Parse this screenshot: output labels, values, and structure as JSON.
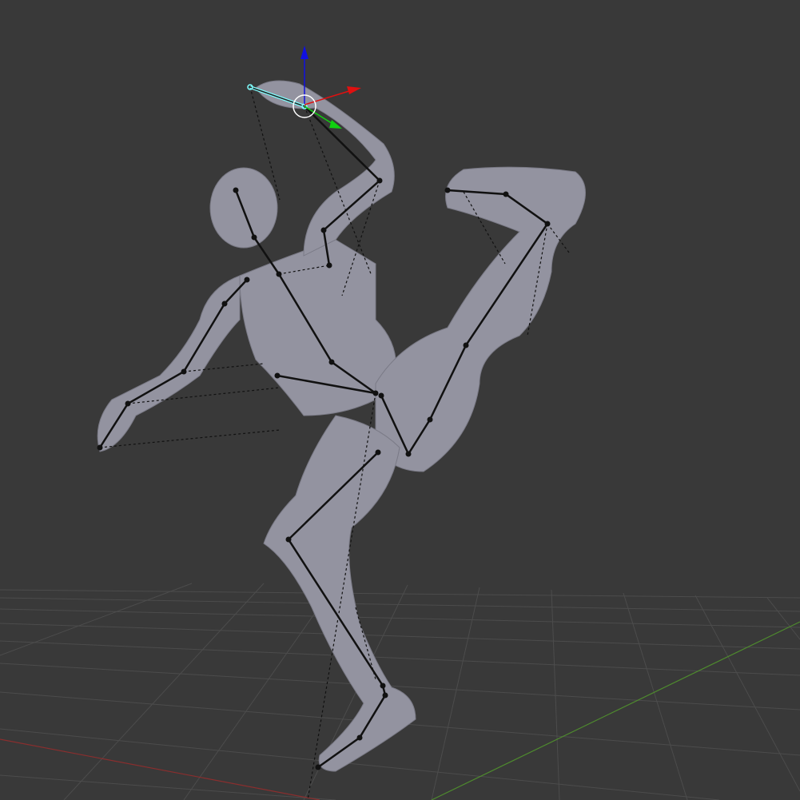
{
  "viewport": {
    "kind": "3d-viewport",
    "background_color": "#393939",
    "grid_color": "#505050",
    "x_axis_color": "#8a2e2e",
    "y_axis_color": "#4e8a2e",
    "mesh_color": "#9a9aa2",
    "bone_color": "#111111",
    "selected_bone_color": "#7fffff"
  },
  "gizmo": {
    "icons": [
      "z-arrow-icon",
      "x-arrow-icon",
      "y-arrow-icon",
      "pivot-circle-icon"
    ],
    "colors": {
      "x": "#e01010",
      "y": "#10d010",
      "z": "#1010e0"
    }
  }
}
